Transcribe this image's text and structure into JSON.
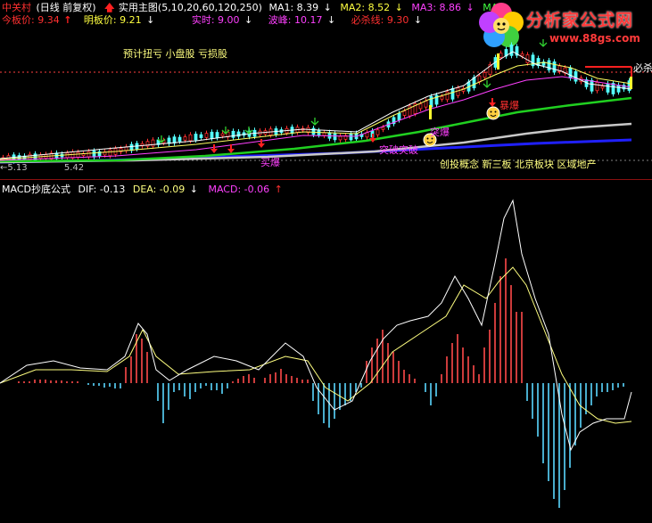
{
  "header": {
    "stock_name": "中关村",
    "period": "(日线 前复权)",
    "indicator_name": "实用主图(5,10,20,60,120,250)",
    "ma1_label": "MA1: 8.39",
    "ma2_label": "MA2: 8.52",
    "ma3_label": "MA3: 8.86",
    "ma4_label": "MA4",
    "limit_up_label": "今板价: 9.34",
    "tomorrow_label": "明板价: 9.21",
    "realtime_label": "实时: 9.00",
    "wave_peak_label": "波峰: 10.17",
    "kill_line_label": "必杀线: 9.30"
  },
  "annotations": {
    "concept_labels": "预计扭亏 小盘股 亏损股",
    "sector_labels": "创投概念 新三板   北京板块    区域地产",
    "must_kill": "必杀",
    "explode_1": "暴爆",
    "explode_2": "突爆",
    "explode_3": "突破突破",
    "buy_signal": "买爆",
    "low_price": "5.13",
    "low_value": "5.42"
  },
  "macd_panel": {
    "title": "MACD抄底公式",
    "dif_label": "DIF: -0.13",
    "dea_label": "DEA: -0.09",
    "macd_label": "MACD: -0.06"
  },
  "logo": {
    "title": "分析家公式网",
    "url": "www.88gs.com"
  },
  "colors": {
    "background": "#000000",
    "up_candle": "#ff3030",
    "down_candle": "#54ffff",
    "macd_positive": "#ff4a4a",
    "macd_negative": "#5ad7ff",
    "dif_line": "#ffffff",
    "dea_line": "#ffff80",
    "ma_green": "#20d020",
    "ma_white": "#c8c8c8",
    "ma_blue": "#2020ff",
    "separator": "#8a1010"
  },
  "chart_data": {
    "type": "bar",
    "title": "MACD抄底公式",
    "series": [
      {
        "name": "DIF",
        "values": [
          -0.13
        ]
      },
      {
        "name": "DEA",
        "values": [
          -0.09
        ]
      },
      {
        "name": "MACD",
        "values": [
          -0.06
        ]
      }
    ]
  }
}
